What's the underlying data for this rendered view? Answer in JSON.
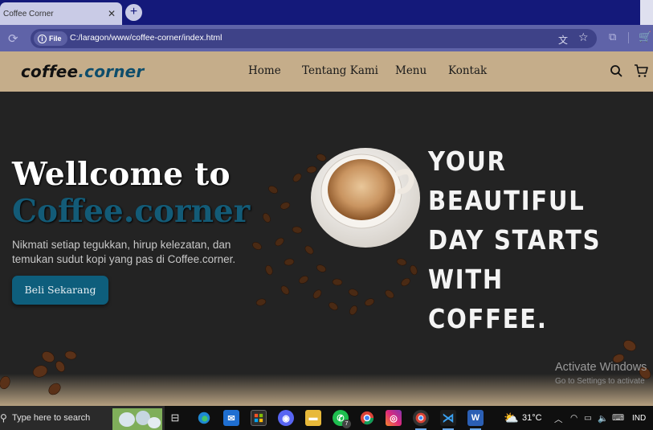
{
  "browser": {
    "tab_title": "Coffee Corner",
    "new_tab_label": "+",
    "security_chip_label": "File",
    "url": "C:/laragon/www/coffee-corner/index.html"
  },
  "site": {
    "logo_part1": "coffee",
    "logo_dot": ".",
    "logo_part2": "corner",
    "nav": [
      "Home",
      "Tentang Kami",
      "Menu",
      "Kontak"
    ],
    "hero": {
      "heading_line1": "Wellcome to",
      "heading_line2": "Coffee.corner",
      "description": "Nikmati setiap tegukkan, hirup kelezatan, dan temukan sudut kopi yang pas di Coffee.corner.",
      "cta_label": "Beli Sekarang",
      "tagline": [
        "YOUR",
        "BEAUTIFUL",
        "DAY STARTS",
        "WITH COFFEE."
      ]
    }
  },
  "windows_watermark": {
    "title": "Activate Windows",
    "subtitle": "Go to Settings to activate"
  },
  "taskbar": {
    "search_placeholder": "Type here to search",
    "whatsapp_badge": "7",
    "temperature": "31°C",
    "language": "IND"
  },
  "colors": {
    "browser_tabbar": "#14197a",
    "address_bar": "#5f63a8",
    "navbar": "#c5ad8a",
    "hero_bg": "#232323",
    "accent_blue": "#0e5e7c"
  }
}
